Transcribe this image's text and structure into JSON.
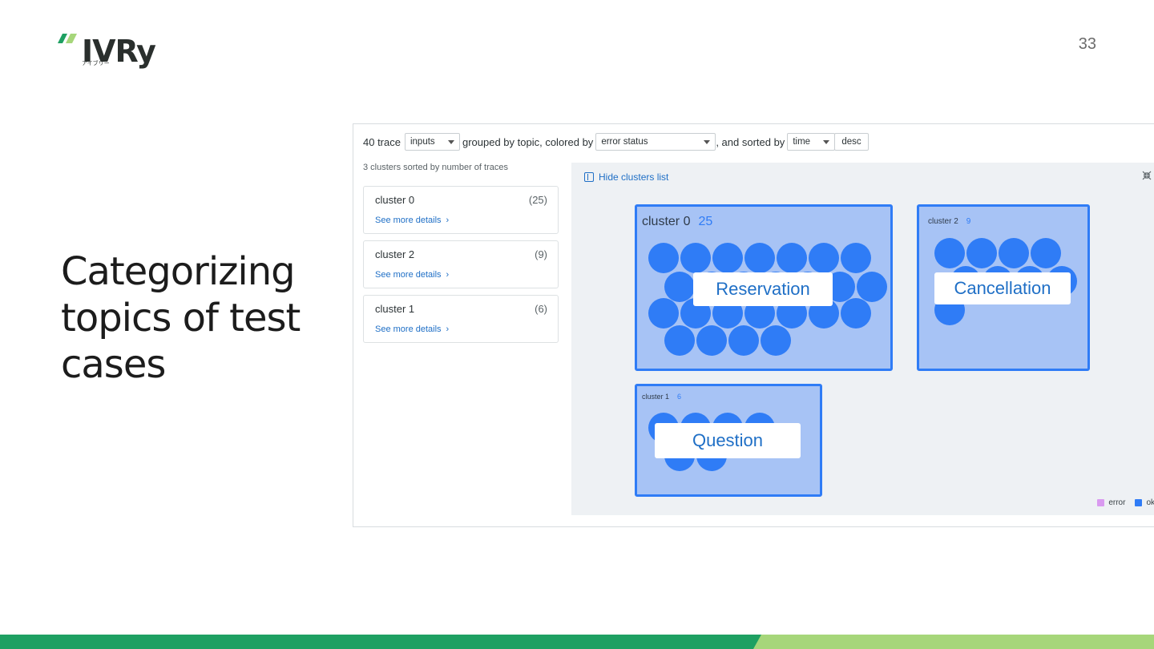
{
  "logo": {
    "text": "IVRy",
    "subtext": "アイブリー",
    "colors": {
      "stripe_dark": "#1ea062",
      "stripe_light": "#a6d67a"
    }
  },
  "page_number": "33",
  "title": "Categorizing topics of test cases",
  "screenshot": {
    "toolbar": {
      "prefix": "40 trace",
      "input_select": "inputs",
      "grouped_text": "grouped by topic, colored by",
      "color_select": "error status",
      "sorted_text": ", and sorted by",
      "sort_select": "time",
      "order_button": "desc"
    },
    "list": {
      "header": "3 clusters sorted by number of traces",
      "clusters": [
        {
          "name": "cluster 0",
          "count": "(25)",
          "link": "See more details"
        },
        {
          "name": "cluster 2",
          "count": "(9)",
          "link": "See more details"
        },
        {
          "name": "cluster 1",
          "count": "(6)",
          "link": "See more details"
        }
      ]
    },
    "panel": {
      "hide_label": "Hide clusters list",
      "collapse_icon": "collapse-icon",
      "clusters": [
        {
          "name": "cluster 0",
          "count": "25",
          "topic": "Reservation"
        },
        {
          "name": "cluster 2",
          "count": "9",
          "topic": "Cancellation"
        },
        {
          "name": "cluster 1",
          "count": "6",
          "topic": "Question"
        }
      ],
      "legend": [
        {
          "label": "error",
          "color": "#d99af0"
        },
        {
          "label": "ok",
          "color": "#2f7cf6"
        }
      ]
    }
  }
}
